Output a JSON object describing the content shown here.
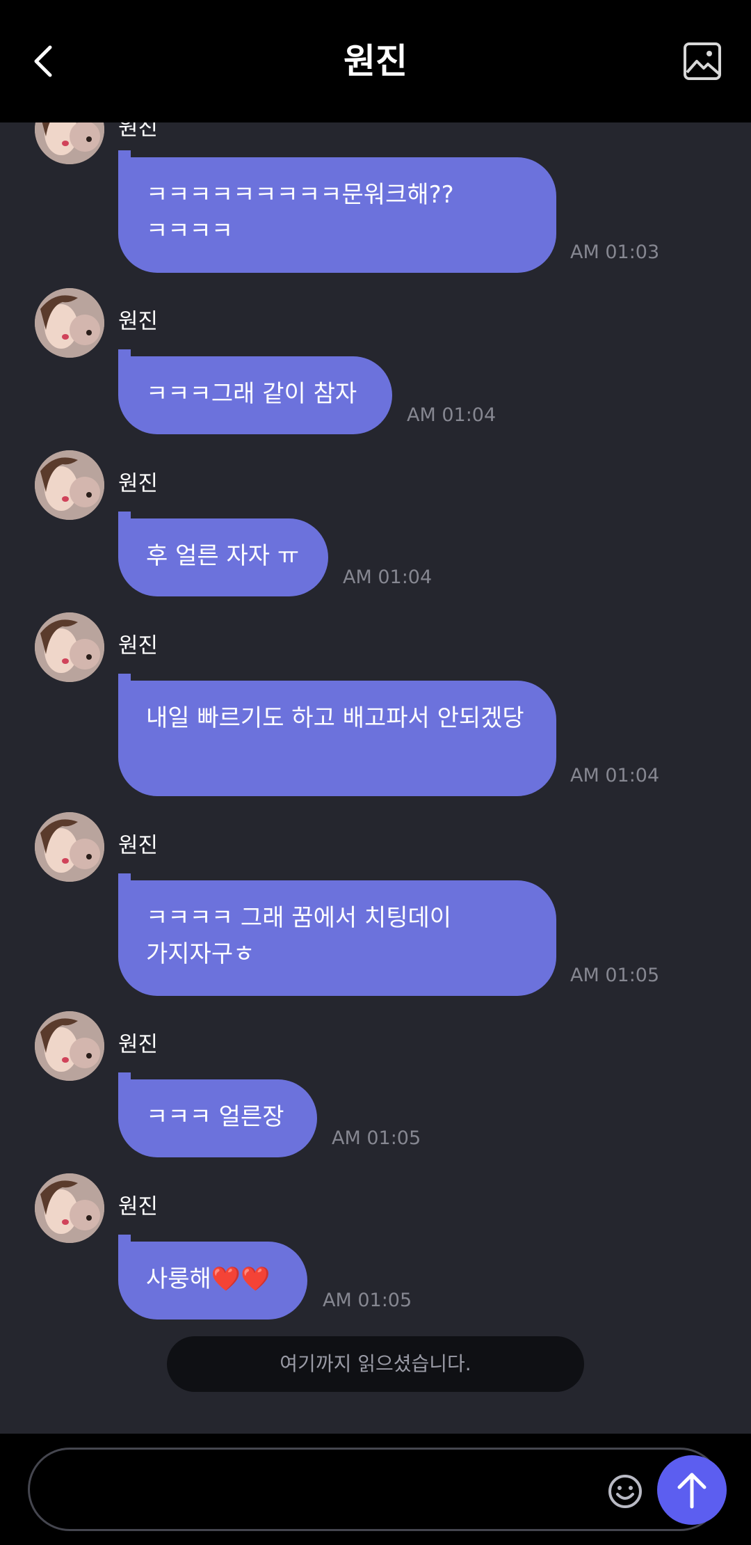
{
  "header": {
    "title": "원진",
    "back_icon": "chevron-left-icon",
    "gallery_icon": "image-icon"
  },
  "messages": [
    {
      "sender": "원진",
      "text": "ㅋㅋㅋㅋㅋㅋㅋㅋㅋ문워크해??ㅋㅋㅋㅋ",
      "time": "AM 01:03"
    },
    {
      "sender": "원진",
      "text": "ㅋㅋㅋ그래 같이 참자",
      "time": "AM 01:04"
    },
    {
      "sender": "원진",
      "text": "후 얼른 자자 ㅠ",
      "time": "AM 01:04"
    },
    {
      "sender": "원진",
      "text": "내일 빠르기도 하고 배고파서 안되겠당",
      "time": "AM 01:04"
    },
    {
      "sender": "원진",
      "text": "ㅋㅋㅋㅋ 그래 꿈에서 치팅데이 가지자구ㅎ",
      "time": "AM 01:05"
    },
    {
      "sender": "원진",
      "text": "ㅋㅋㅋ 얼른장",
      "time": "AM 01:05"
    },
    {
      "sender": "원진",
      "text": "사룽해❤️❤️",
      "time": "AM 01:05"
    }
  ],
  "read_marker": "여기까지 읽으셨습니다.",
  "composer": {
    "placeholder": "",
    "emoji_icon": "smiley-icon",
    "send_icon": "arrow-up-icon"
  },
  "colors": {
    "background": "#25262e",
    "bubble": "#6c72dc",
    "send_button": "#5c5ef0",
    "header": "#000000"
  }
}
